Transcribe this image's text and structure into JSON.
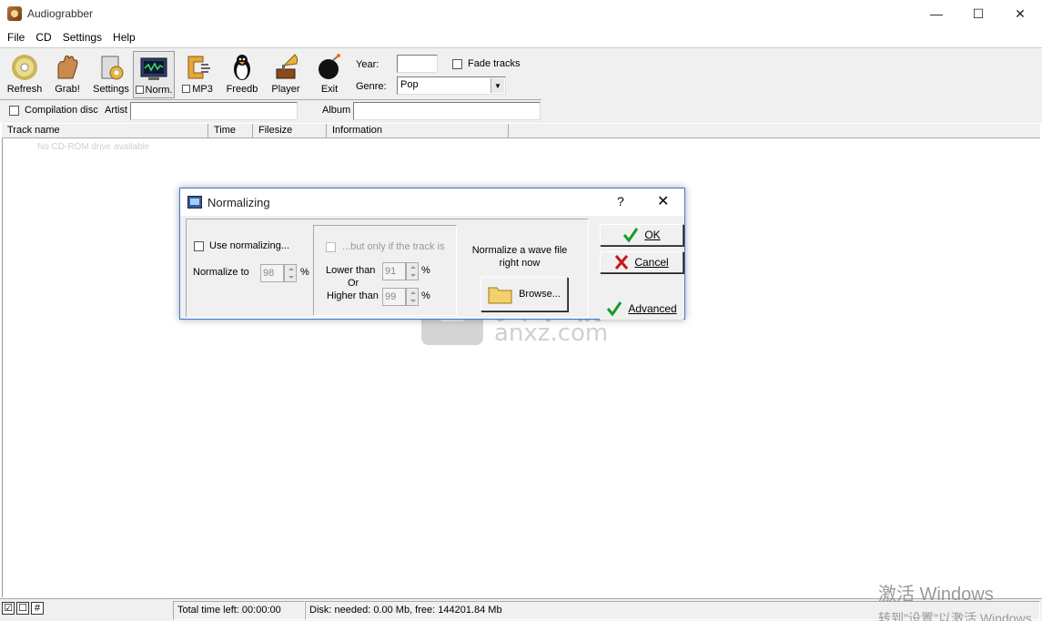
{
  "app": {
    "title": "Audiograbber"
  },
  "window_controls": {
    "minimize": "—",
    "maximize": "☐",
    "close": "✕"
  },
  "menu": [
    "File",
    "CD",
    "Settings",
    "Help"
  ],
  "toolbar": {
    "buttons": [
      {
        "label": "Refresh",
        "icon": "cd-icon"
      },
      {
        "label": "Grab!",
        "icon": "hand-icon"
      },
      {
        "label": "Settings",
        "icon": "settings-icon"
      },
      {
        "label": "Norm.",
        "icon": "monitor-icon",
        "checkbox": true
      },
      {
        "label": "MP3",
        "icon": "mp3-clamp-icon",
        "checkbox": true
      },
      {
        "label": "Freedb",
        "icon": "penguin-icon"
      },
      {
        "label": "Player",
        "icon": "gramophone-icon"
      },
      {
        "label": "Exit",
        "icon": "bomb-icon"
      }
    ],
    "year_label": "Year:",
    "year_value": "",
    "fade_tracks_label": "Fade tracks",
    "genre_label": "Genre:",
    "genre_value": "Pop",
    "compilation_label": "Compilation disc",
    "artist_label": "Artist",
    "artist_value": "",
    "album_label": "Album",
    "album_value": ""
  },
  "list": {
    "columns": [
      "Track name",
      "Time",
      "Filesize",
      "Information"
    ],
    "empty_message": "No CD-ROM drive available"
  },
  "statusbar": {
    "icons": [
      "☑",
      "☐",
      "#"
    ],
    "total_time": "Total time left: 00:00:00",
    "disk": "Disk: needed: 0.00 Mb, free: 144201.84 Mb"
  },
  "dialog": {
    "title": "Normalizing",
    "help": "?",
    "close": "✕",
    "use_normalizing_label": "Use normalizing...",
    "normalize_to_label": "Normalize to",
    "normalize_to_value": "98",
    "percent": "%",
    "only_if_label": "...but only if the track is",
    "lower_than_label": "Lower than",
    "lower_than_value": "91",
    "or_label": "Or",
    "higher_than_label": "Higher than",
    "higher_than_value": "99",
    "normalize_wave_label": "Normalize a wave file right now",
    "browse_label": "Browse...",
    "ok_label": "OK",
    "cancel_label": "Cancel",
    "advanced_label": "Advanced"
  },
  "watermark": {
    "cn": "安下载",
    "domain": "anxz.com"
  },
  "activate": {
    "line1": "激活 Windows",
    "line2": "转到\"设置\"以激活 Windows"
  }
}
